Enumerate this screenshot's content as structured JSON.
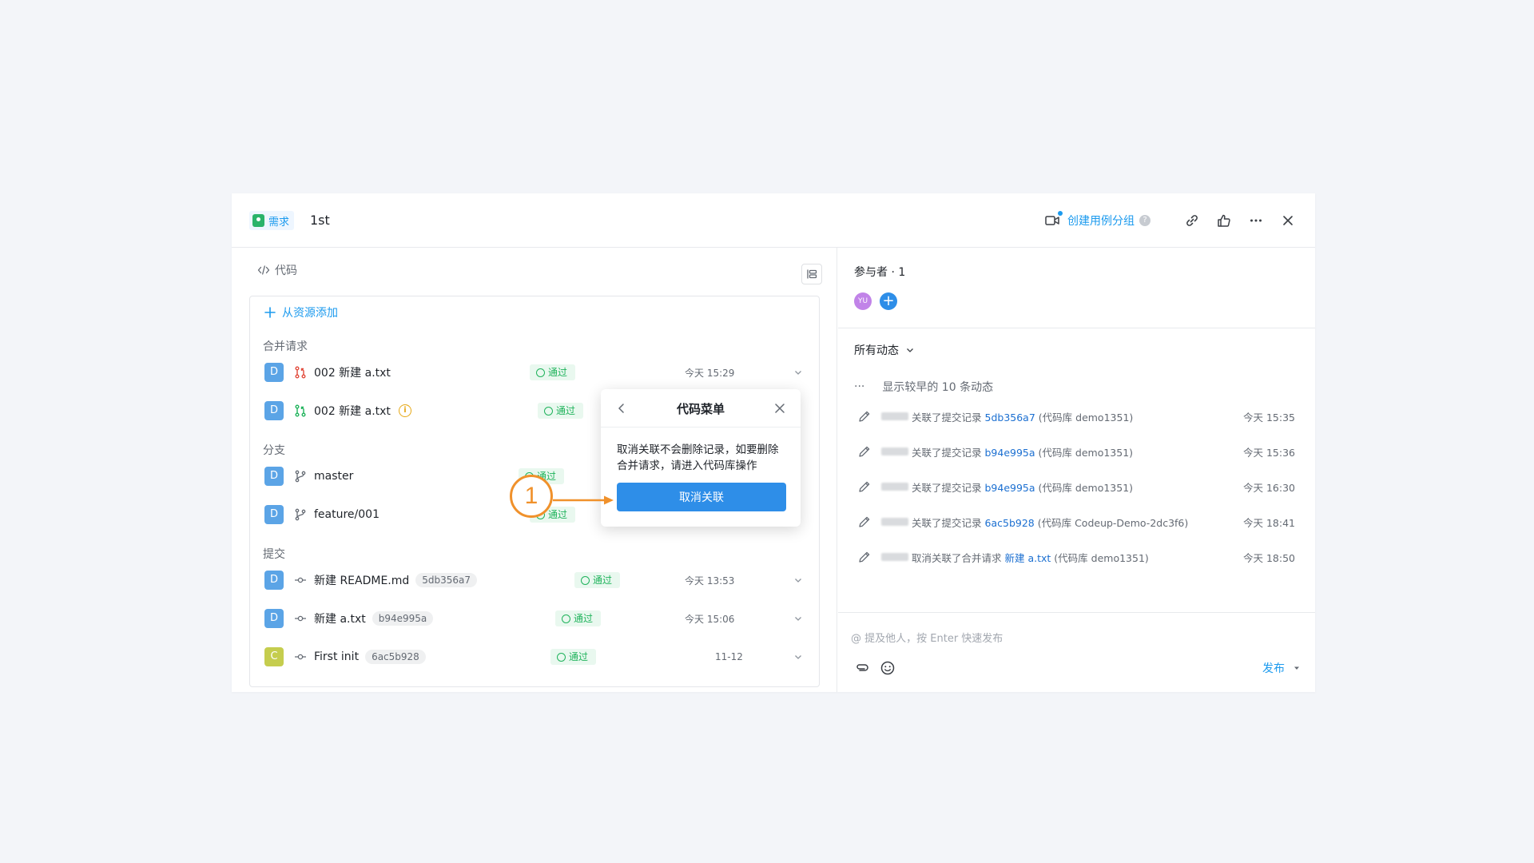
{
  "header": {
    "type_label": "需求",
    "title": "1st",
    "create_group_link": "创建用例分组",
    "help": "?"
  },
  "code_section": {
    "title": "代码",
    "add_from_resource": "从资源添加",
    "merge_requests_label": "合并请求",
    "branches_label": "分支",
    "commits_label": "提交",
    "merge_requests": [
      {
        "avatar": "D",
        "name": "002 新建 a.txt",
        "status": "通过",
        "time": "今天 15:29"
      },
      {
        "avatar": "D",
        "name": "002 新建 a.txt",
        "status": "通过",
        "warn": "i"
      }
    ],
    "branches": [
      {
        "avatar": "D",
        "name": "master",
        "status": "通过"
      },
      {
        "avatar": "D",
        "name": "feature/001",
        "status": "通过"
      }
    ],
    "commits": [
      {
        "avatar": "D",
        "name": "新建 README.md",
        "hash": "5db356a7",
        "status": "通过",
        "time": "今天 13:53"
      },
      {
        "avatar": "D",
        "name": "新建 a.txt",
        "hash": "b94e995a",
        "status": "通过",
        "time": "今天 15:06"
      },
      {
        "avatar": "C",
        "name": "First init",
        "hash": "6ac5b928",
        "status": "通过",
        "time": "11-12"
      }
    ]
  },
  "popup": {
    "title": "代码菜单",
    "body": "取消关联不会删除记录，如要删除合并请求，请进入代码库操作",
    "button": "取消关联"
  },
  "step_marker": "1",
  "participants": {
    "title": "参与者 · 1",
    "avatar_initials": "YU",
    "add": "+"
  },
  "activity": {
    "filter": "所有动态",
    "more_dots": "···",
    "show_older": "显示较早的 10 条动态",
    "items": [
      {
        "action": "关联了提交记录",
        "link": "5db356a7",
        "repo": "(代码库 demo1351)",
        "time": "今天 15:35"
      },
      {
        "action": "关联了提交记录",
        "link": "b94e995a",
        "repo": "(代码库 demo1351)",
        "time": "今天 15:36"
      },
      {
        "action": "关联了提交记录",
        "link": "b94e995a",
        "repo": "(代码库 demo1351)",
        "time": "今天 16:30"
      },
      {
        "action": "关联了提交记录",
        "link": "6ac5b928",
        "repo": "(代码库 Codeup-Demo-2dc3f6)",
        "time": "今天 18:41"
      },
      {
        "action": "取消关联了合并请求",
        "link": "新建 a.txt",
        "repo": "(代码库 demo1351)",
        "time": "今天 18:50"
      }
    ]
  },
  "composer": {
    "placeholder": "@ 提及他人，按 Enter 快速发布",
    "publish": "发布"
  },
  "colors": {
    "accent": "#1b9aee",
    "button": "#2e8ee8",
    "pass_green": "#1fb35b",
    "step_orange": "#f0912b"
  }
}
